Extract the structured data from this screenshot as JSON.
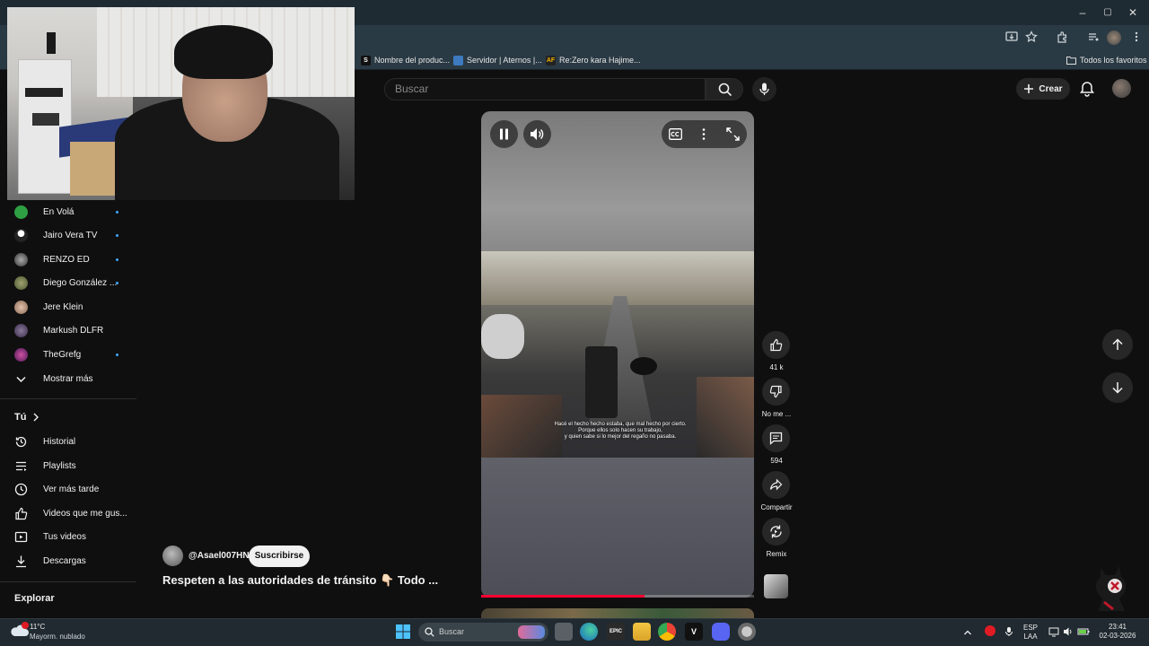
{
  "browser": {
    "window_controls": {
      "minimize": "–",
      "maximize": "▢",
      "close": "✕"
    },
    "bookmarks": [
      {
        "label": "Nombre del produc..."
      },
      {
        "label": "Servidor | Aternos |..."
      },
      {
        "label": "Re:Zero kara Hajime..."
      }
    ],
    "all_bookmarks": "Todos los favoritos"
  },
  "header": {
    "search_placeholder": "Buscar",
    "create_label": "Crear"
  },
  "sidebar": {
    "subscriptions": [
      {
        "label": "En Volá",
        "color": "#2ea043",
        "new": true
      },
      {
        "label": "Jairo Vera TV",
        "color": "#ffffff",
        "new": true
      },
      {
        "label": "RENZO ED",
        "color": "#555555",
        "new": true
      },
      {
        "label": "Diego González ...",
        "color": "#7a8a55",
        "new": true
      },
      {
        "label": "Jere Klein",
        "color": "#c9a48a",
        "new": false
      },
      {
        "label": "Markush DLFR",
        "color": "#5a4a6a",
        "new": false
      },
      {
        "label": "TheGrefg",
        "color": "#9a2a6a",
        "new": true
      }
    ],
    "show_more": "Mostrar más",
    "you_header": "Tú",
    "you_items": [
      {
        "label": "Historial",
        "icon": "history-icon"
      },
      {
        "label": "Playlists",
        "icon": "playlists-icon"
      },
      {
        "label": "Ver más tarde",
        "icon": "watch-later-icon"
      },
      {
        "label": "Videos que me gus...",
        "icon": "liked-videos-icon"
      },
      {
        "label": "Tus videos",
        "icon": "your-videos-icon"
      },
      {
        "label": "Descargas",
        "icon": "downloads-icon"
      }
    ],
    "explore_header": "Explorar"
  },
  "short": {
    "channel": "@Asael007HN",
    "subscribe_label": "Suscribirse",
    "title": "Respeten a las autoridades de tránsito 👇🏻 Todo ...",
    "subtitle_lines": [
      "Hacé el hecho hecho estaba, que mal hecho por cierto.",
      "Porque ellos solo hacen su trabajo,",
      "y quien sabe si lo mejor del regaño no pasaba."
    ],
    "progress": 0.6,
    "actions": [
      {
        "label": "41 k",
        "icon": "like-icon"
      },
      {
        "label": "No me ...",
        "icon": "dislike-icon"
      },
      {
        "label": "594",
        "icon": "comments-icon"
      },
      {
        "label": "Compartir",
        "icon": "share-icon"
      },
      {
        "label": "Remix",
        "icon": "remix-icon"
      }
    ]
  },
  "taskbar": {
    "weather_temp": "11°C",
    "weather_desc": "Mayorm. nublado",
    "search_placeholder": "Buscar",
    "lang": "ESP",
    "lang2": "LAA",
    "time": "23:41",
    "date": "02-03-2026"
  }
}
